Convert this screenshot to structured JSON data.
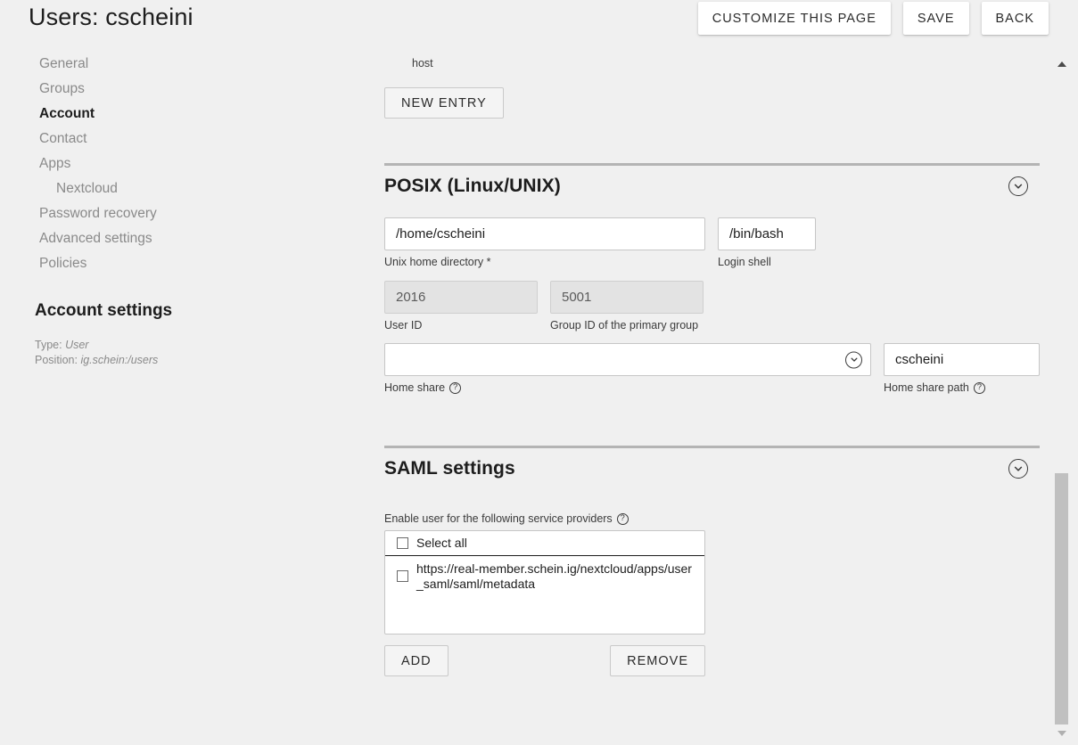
{
  "header": {
    "title": "Users: cscheini",
    "buttons": [
      {
        "label": "CUSTOMIZE THIS PAGE",
        "name": "customize-this-page-button"
      },
      {
        "label": "SAVE",
        "name": "save-button"
      },
      {
        "label": "BACK",
        "name": "back-button"
      }
    ]
  },
  "sidebar": {
    "items": [
      {
        "label": "General",
        "active": false,
        "sub": false
      },
      {
        "label": "Groups",
        "active": false,
        "sub": false
      },
      {
        "label": "Account",
        "active": true,
        "sub": false
      },
      {
        "label": "Contact",
        "active": false,
        "sub": false
      },
      {
        "label": "Apps",
        "active": false,
        "sub": false
      },
      {
        "label": "Nextcloud",
        "active": false,
        "sub": true
      },
      {
        "label": "Password recovery",
        "active": false,
        "sub": false
      },
      {
        "label": "Advanced settings",
        "active": false,
        "sub": false
      },
      {
        "label": "Policies",
        "active": false,
        "sub": false
      }
    ],
    "account_settings_title": "Account settings",
    "meta": {
      "type_label": "Type:",
      "type_value": "User",
      "position_label": "Position:",
      "position_value": "ig.schein:/users"
    }
  },
  "content": {
    "clipped_label": "host",
    "new_entry_label": "NEW ENTRY",
    "posix": {
      "title": "POSIX (Linux/UNIX)",
      "collapse_icon": "chevron-down-circle-icon",
      "home_directory": {
        "value": "/home/cscheini",
        "label": "Unix home directory *"
      },
      "login_shell": {
        "value": "/bin/bash",
        "label": "Login shell"
      },
      "user_id": {
        "value": "2016",
        "label": "User ID"
      },
      "group_id": {
        "value": "5001",
        "label": "Group ID of the primary group"
      },
      "home_share": {
        "value": "",
        "label": "Home share",
        "help": "help-icon"
      },
      "home_share_path": {
        "value": "cscheini",
        "label": "Home share path",
        "help": "help-icon"
      }
    },
    "saml": {
      "title": "SAML settings",
      "collapse_icon": "chevron-down-circle-icon",
      "providers_label": "Enable user for the following service providers",
      "providers_help": "help-icon",
      "select_all_label": "Select all",
      "select_all_checked": false,
      "providers": [
        {
          "label": "https://real-member.schein.ig/nextcloud/apps/user_saml/saml/metadata",
          "checked": false
        }
      ],
      "add_label": "ADD",
      "remove_label": "REMOVE"
    }
  },
  "scrollbar": {
    "up_icon": "scroll-up-arrow-icon",
    "down_icon": "scroll-down-arrow-icon"
  },
  "colors": {
    "background": "#f0f0f0",
    "divider": "#b4b4b4",
    "muted_text": "#8a8a8a",
    "text": "#1d1d1d"
  }
}
